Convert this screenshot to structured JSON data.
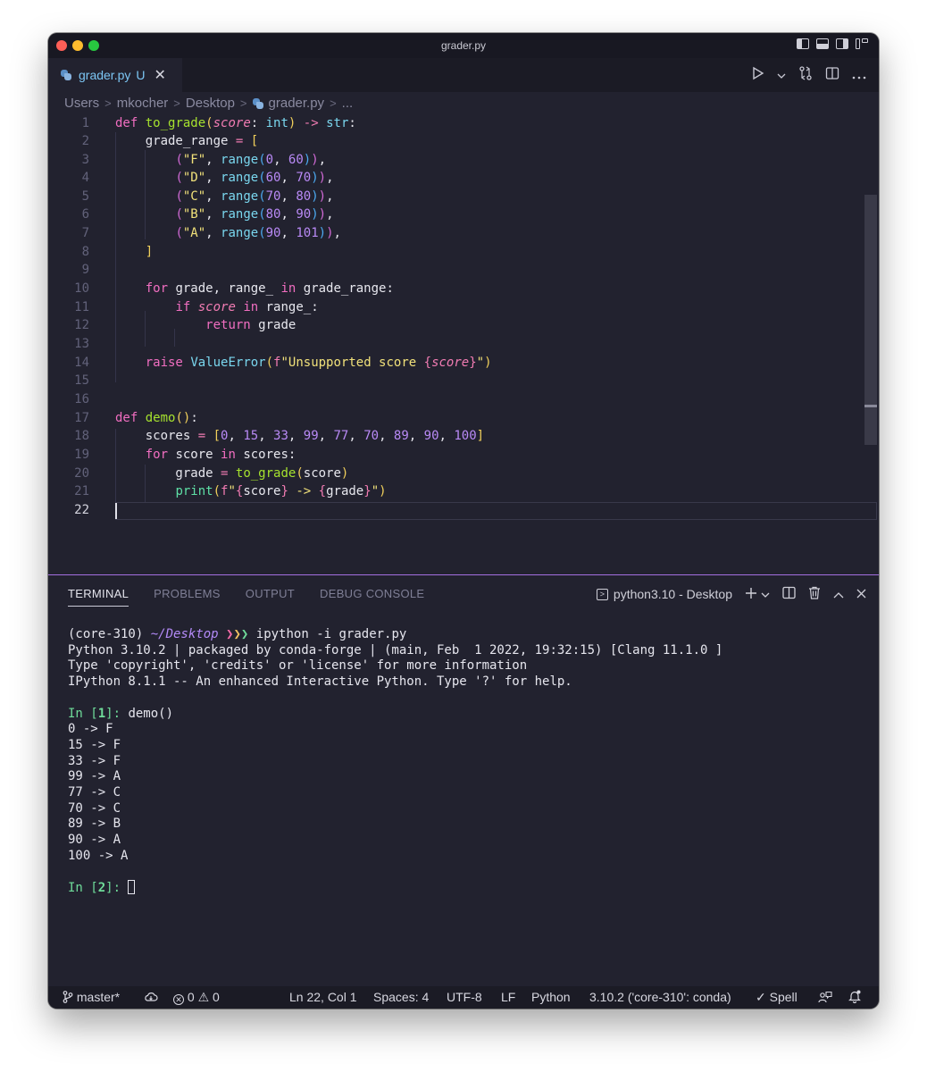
{
  "window": {
    "title": "grader.py"
  },
  "tab": {
    "label": "grader.py",
    "status": "U",
    "close": "✕"
  },
  "breadcrumb": {
    "items": [
      "Users",
      "mkocher",
      "Desktop",
      "grader.py",
      "..."
    ]
  },
  "editor": {
    "line_numbers": [
      "1",
      "2",
      "3",
      "4",
      "5",
      "6",
      "7",
      "8",
      "9",
      "10",
      "11",
      "12",
      "13",
      "14",
      "15",
      "16",
      "17",
      "18",
      "19",
      "20",
      "21",
      "22"
    ],
    "active_line": 22
  },
  "panel": {
    "tabs": [
      "TERMINAL",
      "PROBLEMS",
      "OUTPUT",
      "DEBUG CONSOLE"
    ],
    "active_tab": "TERMINAL",
    "terminal_name": "python3.10 - Desktop",
    "terminal": {
      "prompt_env": "(core-310) ",
      "prompt_path": "~/Desktop",
      "prompt_cmd": "ipython -i grader.py",
      "info_lines": [
        "Python 3.10.2 | packaged by conda-forge | (main, Feb  1 2022, 19:32:15) [Clang 11.1.0 ]",
        "Type 'copyright', 'credits' or 'license' for more information",
        "IPython 8.1.1 -- An enhanced Interactive Python. Type '?' for help."
      ],
      "in1_label": "In [",
      "in1_num": "1",
      "in1_close": "]: ",
      "in1_cmd": "demo()",
      "output": [
        "0 -> F",
        "15 -> F",
        "33 -> F",
        "99 -> A",
        "77 -> C",
        "70 -> C",
        "89 -> B",
        "90 -> A",
        "100 -> A"
      ],
      "in2_label": "In [",
      "in2_num": "2",
      "in2_close": "]: "
    }
  },
  "statusbar": {
    "branch": "master*",
    "errors": "0",
    "warnings": "0",
    "position": "Ln 22, Col 1",
    "spaces": "Spaces: 4",
    "encoding": "UTF-8",
    "eol": "LF",
    "language": "Python",
    "interpreter": "3.10.2 ('core-310': conda)",
    "spell": "Spell"
  },
  "colors": {
    "background": "#22222f",
    "keyword": "#f16ec1",
    "function": "#a6e22e",
    "string": "#f1e17a",
    "number": "#b98af6",
    "panel_accent": "#a46fe0"
  }
}
